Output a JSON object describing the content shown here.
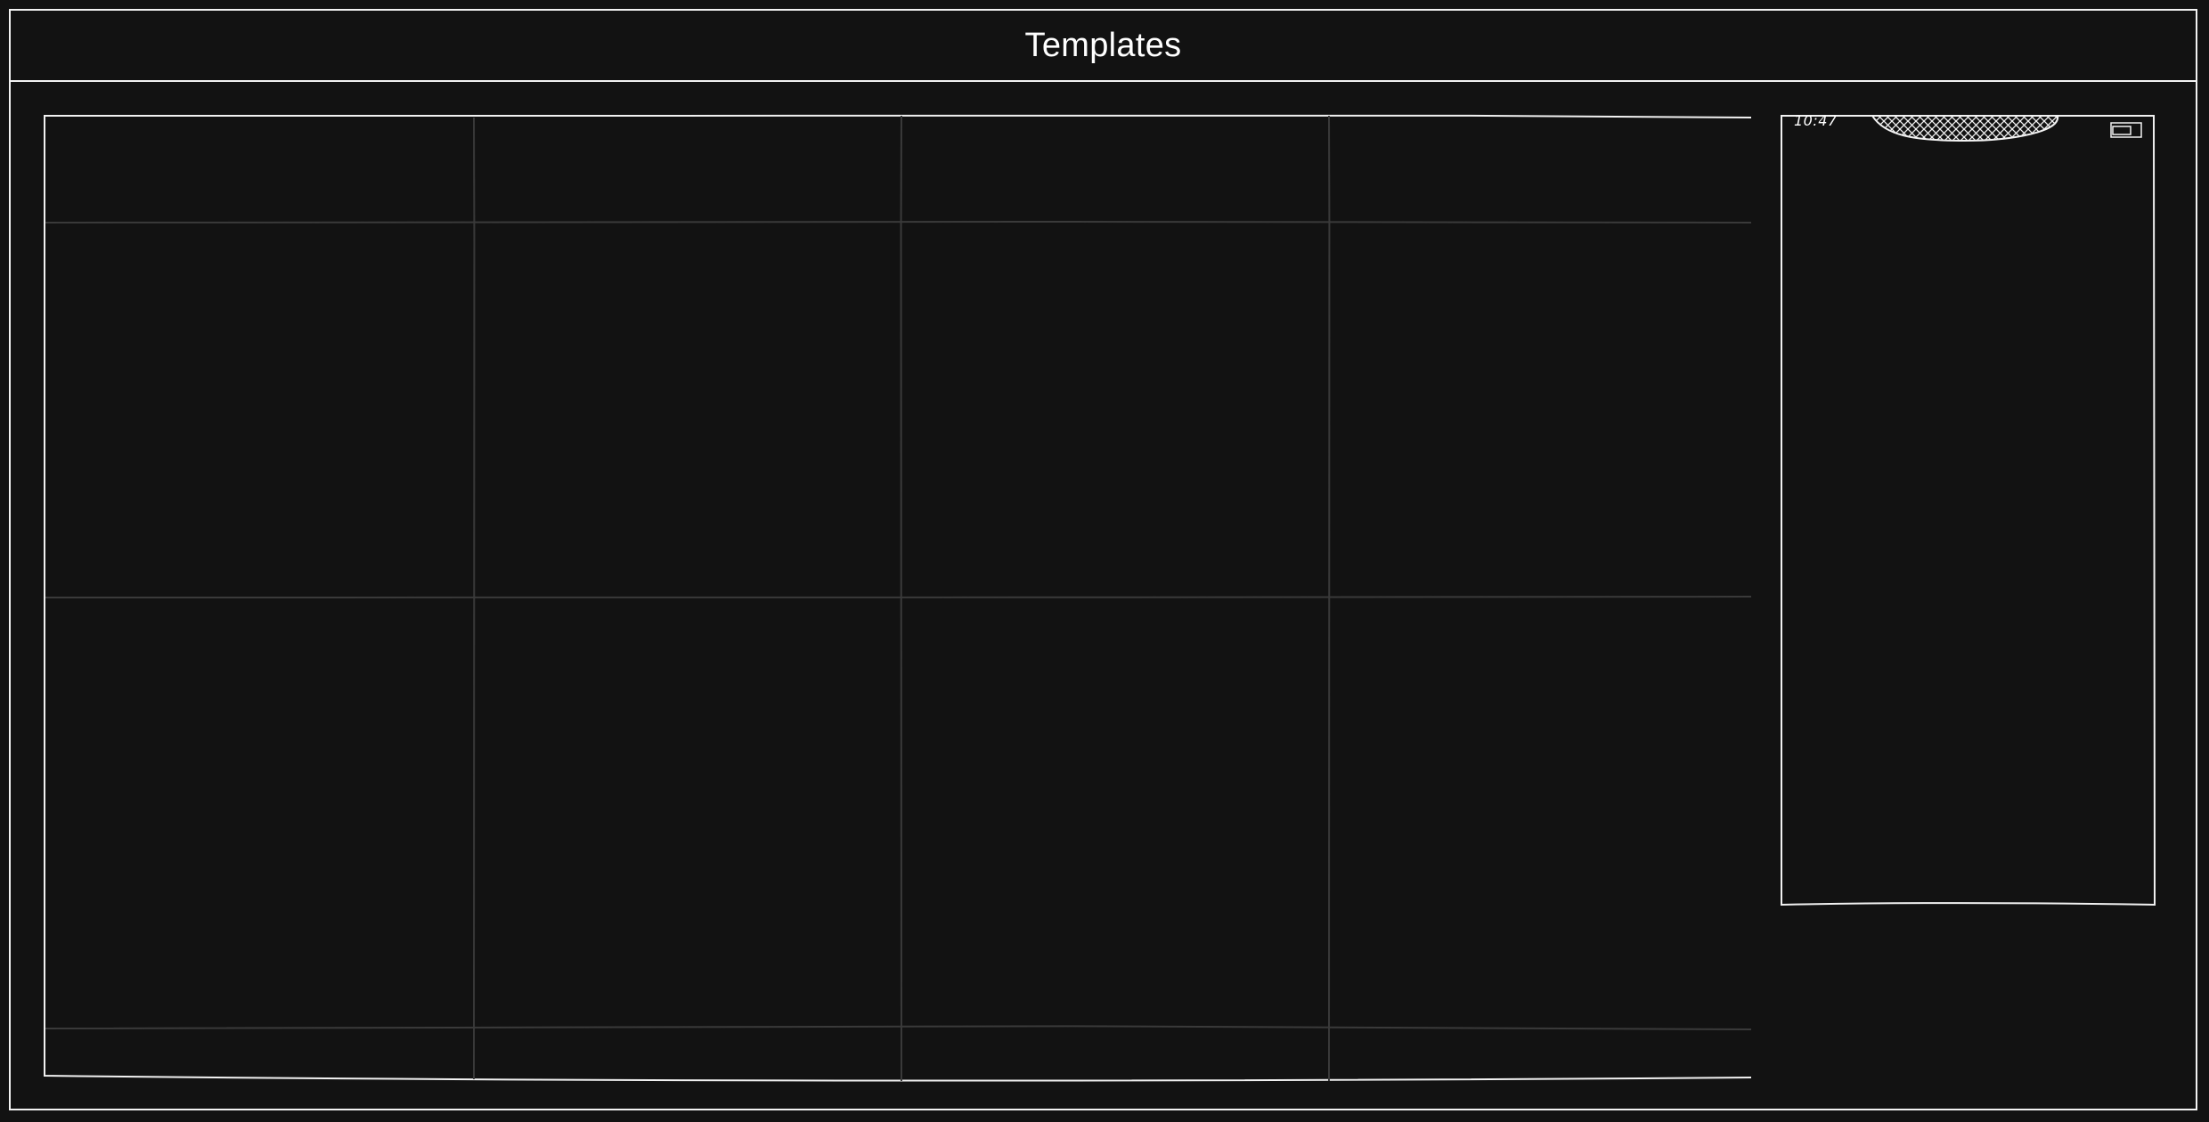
{
  "header": {
    "title": "Templates"
  },
  "device_preview": {
    "time": "10:47",
    "icons": {
      "notch": "notch-icon",
      "battery": "battery-icon"
    }
  },
  "canvas": {
    "columns": 4,
    "rows": 2,
    "has_header_band": true,
    "has_footer_band": true
  },
  "colors": {
    "background": "#121212",
    "stroke": "#f2f2f2",
    "grid_line": "#3a3a3a"
  }
}
